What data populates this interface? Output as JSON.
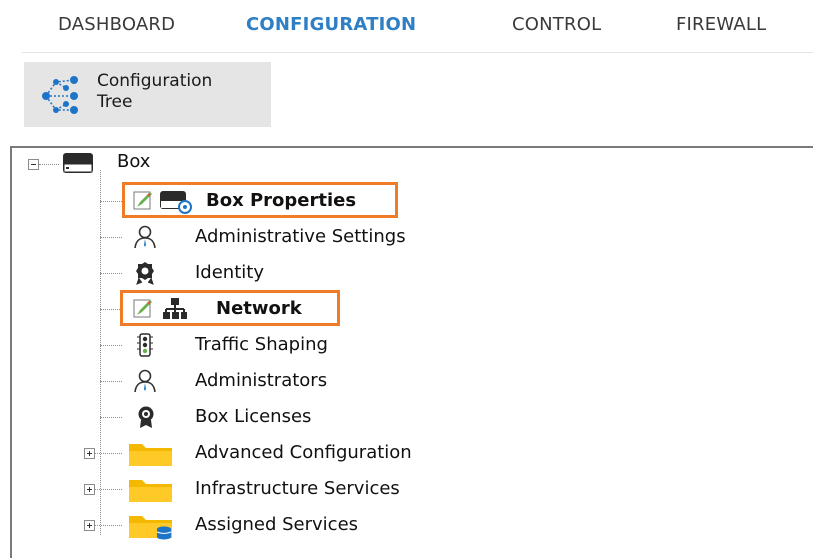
{
  "nav": {
    "tabs": [
      {
        "label": "DASHBOARD",
        "active": false
      },
      {
        "label": "CONFIGURATION",
        "active": true
      },
      {
        "label": "CONTROL",
        "active": false
      },
      {
        "label": "FIREWALL",
        "active": false
      }
    ]
  },
  "toolbar": {
    "config_tree_line1": "Configuration",
    "config_tree_line2": "Tree"
  },
  "tree": {
    "root": "Box",
    "items": [
      {
        "label": "Box Properties",
        "highlighted": true,
        "icon": "box-properties-icon"
      },
      {
        "label": "Administrative Settings",
        "icon": "admin-user-icon"
      },
      {
        "label": "Identity",
        "icon": "identity-badge-icon"
      },
      {
        "label": "Network",
        "highlighted": true,
        "icon": "network-icon"
      },
      {
        "label": "Traffic Shaping",
        "icon": "traffic-light-icon"
      },
      {
        "label": "Administrators",
        "icon": "admin-user-icon"
      },
      {
        "label": "Box Licenses",
        "icon": "license-seal-icon"
      },
      {
        "label": "Advanced Configuration",
        "icon": "folder-icon",
        "expandable": true
      },
      {
        "label": "Infrastructure Services",
        "icon": "folder-icon",
        "expandable": true
      },
      {
        "label": "Assigned Services",
        "icon": "folder-database-icon",
        "expandable": true
      }
    ]
  },
  "colors": {
    "accent": "#2f7fc4",
    "highlight": "#f07c28",
    "folder": "#f5b800"
  }
}
